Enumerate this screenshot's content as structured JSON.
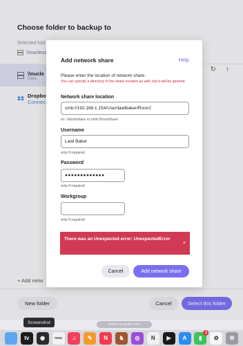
{
  "background_dialog": {
    "title": "Choose folder to backup to",
    "selected_label": "Selected fold",
    "selected_path": "\\\\nucleus",
    "list": [
      {
        "name": "\\\\nucle",
        "sub": "Data"
      },
      {
        "name": "Dropbo",
        "sub": "Connec"
      }
    ],
    "add_label": "+ Add netw",
    "new_folder_label": "New folder",
    "cancel_label": "Cancel",
    "select_label": "Select this folder"
  },
  "tooltip": "Screenshot",
  "bottom_pill": "Select an audio zone",
  "modal": {
    "title": "Add network share",
    "help": "Help",
    "description": "Please enter the location of network share.",
    "note": "You can specify a directory in the share location as well, but it will be ignored.",
    "share_location": {
      "label": "Network share location",
      "value": "smb://192.168.1.154/User/lawlbaker/Roon2",
      "help": "ex: \\\\host\\share or smb://host/share"
    },
    "username": {
      "label": "Username",
      "value": "Lawl Baker",
      "help": "only if required"
    },
    "password": {
      "label": "Password",
      "value": "●●●●●●●●●●●●●",
      "help": "only if required"
    },
    "workgroup": {
      "label": "Workgroup",
      "value": "",
      "help": "only if required"
    },
    "error_text": "There was an Unexpected error: UnexpectedError",
    "error_close": "×",
    "cancel_label": "Cancel",
    "add_label": "Add network share"
  },
  "dock": [
    {
      "name": "finder-icon",
      "glyph": "",
      "color": "#5aa7f0"
    },
    {
      "name": "apple-tv-icon",
      "glyph": "tv",
      "color": "#1c1c1c"
    },
    {
      "name": "camera-icon",
      "glyph": "◉",
      "color": "#2a2a2a"
    },
    {
      "name": "roon-icon",
      "glyph": "roon",
      "color": "#f2f2f2"
    },
    {
      "name": "music-icon",
      "glyph": "♫",
      "color": "#f0405a"
    },
    {
      "name": "pages-icon",
      "glyph": "✎",
      "color": "#f59b2a"
    },
    {
      "name": "news-icon",
      "glyph": "N",
      "color": "#ef3b4d"
    },
    {
      "name": "chess-icon",
      "glyph": "♞",
      "color": "#a0552a"
    },
    {
      "name": "podcasts-icon",
      "glyph": "◎",
      "color": "#9a4ed8"
    },
    {
      "name": "news2-icon",
      "glyph": "N",
      "color": "#f0f0f0"
    },
    {
      "name": "tv-icon",
      "glyph": "▶",
      "color": "#1a1a1a"
    },
    {
      "name": "appstore-icon",
      "glyph": "A",
      "color": "#2b8cf0"
    },
    {
      "name": "facetime-icon",
      "glyph": "▮",
      "color": "#3cc45a",
      "badge": "1"
    },
    {
      "name": "photos-icon",
      "glyph": "✿",
      "color": "#f6f6f6"
    },
    {
      "name": "settings-icon",
      "glyph": "⚙",
      "color": "#9a9aa2"
    }
  ]
}
